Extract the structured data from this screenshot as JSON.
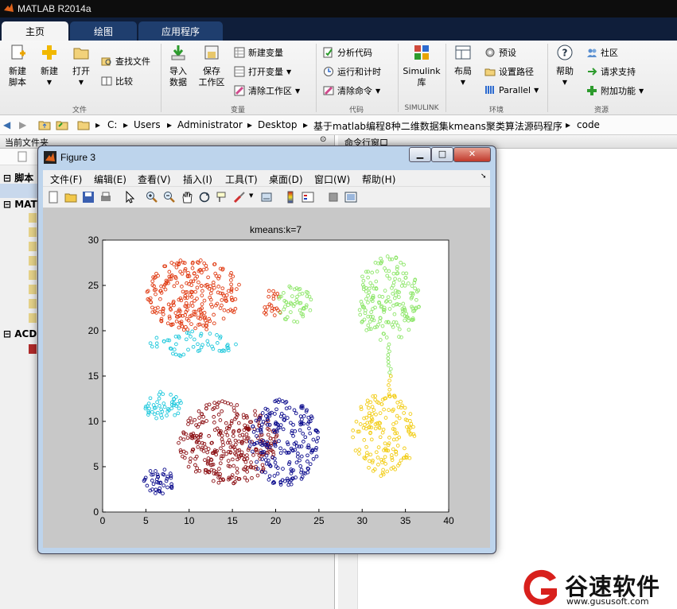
{
  "app": {
    "title": "MATLAB R2014a"
  },
  "tabs": [
    "主页",
    "绘图",
    "应用程序"
  ],
  "ribbon": {
    "new_script": "新建\n脚本",
    "new": "新建",
    "open": "打开",
    "find_files": "查找文件",
    "compare": "比较",
    "import_data": "导入\n数据",
    "save_workspace": "保存\n工作区",
    "new_variable": "新建变量",
    "open_variable": "打开变量",
    "clear_workspace": "清除工作区",
    "analyze_code": "分析代码",
    "run_and_time": "运行和计时",
    "clear_commands": "清除命令",
    "simulink_library": "Simulink\n库",
    "layout": "布局",
    "preferences": "预设",
    "set_path": "设置路径",
    "parallel": "Parallel",
    "help": "帮助",
    "community": "社区",
    "request_support": "请求支持",
    "add_ons": "附加功能",
    "sections": {
      "file": "文件",
      "variable": "变量",
      "code": "代码",
      "simulink": "SIMULINK",
      "environment": "环境",
      "resources": "资源"
    }
  },
  "address": {
    "crumbs": [
      "C:",
      "Users",
      "Administrator",
      "Desktop",
      "基于matlab编程8种二维数据集kmeans聚类算法源码程序",
      "code"
    ]
  },
  "panels": {
    "current_folder": "当前文件夹",
    "command_window": "命令行窗口",
    "tree_items": [
      "脚本",
      "MATL",
      "ACD"
    ]
  },
  "figure": {
    "title": "Figure 3",
    "menus": [
      "文件(F)",
      "编辑(E)",
      "查看(V)",
      "插入(I)",
      "工具(T)",
      "桌面(D)",
      "窗口(W)",
      "帮助(H)"
    ],
    "toolbar_icons": [
      "new-figure-icon",
      "open-file-icon",
      "save-icon",
      "print-icon",
      "pointer-icon",
      "zoom-in-icon",
      "zoom-out-icon",
      "pan-icon",
      "rotate-icon",
      "data-cursor-icon",
      "brush-icon",
      "link-icon",
      "colorbar-icon",
      "legend-icon",
      "hide-tools-icon",
      "dock-icon"
    ]
  },
  "chart_data": {
    "type": "scatter",
    "title": "kmeans:k=7",
    "xlabel": "",
    "ylabel": "",
    "xlim": [
      0,
      40
    ],
    "ylim": [
      0,
      30
    ],
    "xticks": [
      0,
      5,
      10,
      15,
      20,
      25,
      30,
      35,
      40
    ],
    "yticks": [
      0,
      5,
      10,
      15,
      20,
      25,
      30
    ],
    "marker": "open-circle",
    "grid": false,
    "clusters": [
      {
        "color": "#e03c14",
        "shape": "blob",
        "cx": 10.5,
        "cy": 24.0,
        "rx": 5.5,
        "ry": 4.0,
        "n": 260
      },
      {
        "color": "#e03c14",
        "shape": "blob",
        "cx": 19.5,
        "cy": 23.0,
        "rx": 1.3,
        "ry": 1.5,
        "n": 22
      },
      {
        "color": "#1ec8dc",
        "shape": "blob",
        "cx": 10.5,
        "cy": 18.6,
        "rx": 5.0,
        "ry": 1.5,
        "n": 55
      },
      {
        "color": "#1ec8dc",
        "shape": "blob",
        "cx": 7.0,
        "cy": 11.7,
        "rx": 2.2,
        "ry": 1.7,
        "n": 48
      },
      {
        "color": "#8ee66a",
        "shape": "blob",
        "cx": 22.2,
        "cy": 23.0,
        "rx": 2.2,
        "ry": 2.1,
        "n": 50
      },
      {
        "color": "#8ee66a",
        "shape": "blob",
        "cx": 33.0,
        "cy": 23.5,
        "rx": 3.7,
        "ry": 4.8,
        "n": 180
      },
      {
        "color": "#8ee66a",
        "shape": "line",
        "x1": 33.0,
        "y1": 18.5,
        "x2": 33.3,
        "y2": 15.0,
        "n": 10
      },
      {
        "color": "#f2cc12",
        "shape": "line",
        "x1": 33.4,
        "y1": 15.0,
        "x2": 33.0,
        "y2": 13.0,
        "n": 5
      },
      {
        "color": "#f2cc12",
        "shape": "blob",
        "cx": 32.5,
        "cy": 8.5,
        "rx": 3.6,
        "ry": 4.6,
        "n": 160
      },
      {
        "color": "#8c1014",
        "shape": "blob",
        "cx": 14.5,
        "cy": 7.7,
        "rx": 5.8,
        "ry": 4.6,
        "n": 320
      },
      {
        "color": "#0a0a8c",
        "shape": "blob",
        "cx": 21.0,
        "cy": 7.7,
        "rx": 4.0,
        "ry": 4.8,
        "n": 210
      },
      {
        "color": "#0a0a8c",
        "shape": "blob",
        "cx": 6.5,
        "cy": 3.4,
        "rx": 1.8,
        "ry": 1.4,
        "n": 42
      }
    ]
  },
  "watermark": {
    "brand": "谷速软件",
    "url": "www.gususoft.com"
  }
}
